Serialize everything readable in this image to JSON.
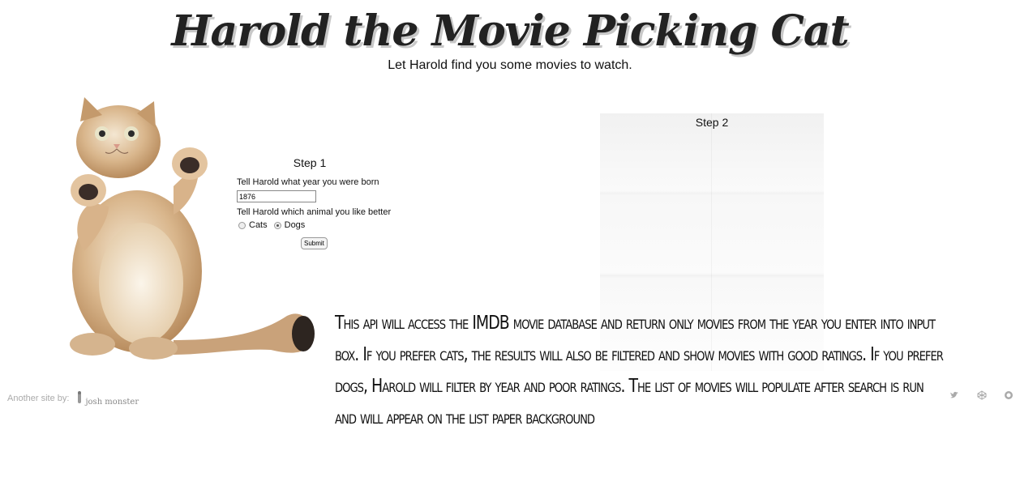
{
  "header": {
    "title": "Harold the Movie Picking Cat",
    "subtitle": "Let Harold find you some movies to watch."
  },
  "step1": {
    "heading": "Step 1",
    "year_prompt": "Tell Harold what year you were born",
    "year_value": "1876",
    "animal_prompt": "Tell Harold which animal you like better",
    "options": [
      "Cats",
      "Dogs"
    ],
    "selected": "Dogs",
    "submit_label": "Submit"
  },
  "step2": {
    "heading": "Step 2"
  },
  "description": "This api will access the IMDB movie database and return only movies from the year you enter into input box. If you prefer cats, the results will also be filtered and show movies with good ratings. If you prefer dogs, Harold will filter by year and poor ratings. The list of movies will populate after search is run and will appear on the list paper background",
  "footer": {
    "credit_label": "Another site by:",
    "logo_text": "josh monster",
    "social_icons": [
      "twitter-icon",
      "codepen-icon",
      "github-icon"
    ]
  },
  "colors": {
    "text": "#222222",
    "title_shadow": "#c8c8c8",
    "footer_text": "#aaaaaa"
  }
}
